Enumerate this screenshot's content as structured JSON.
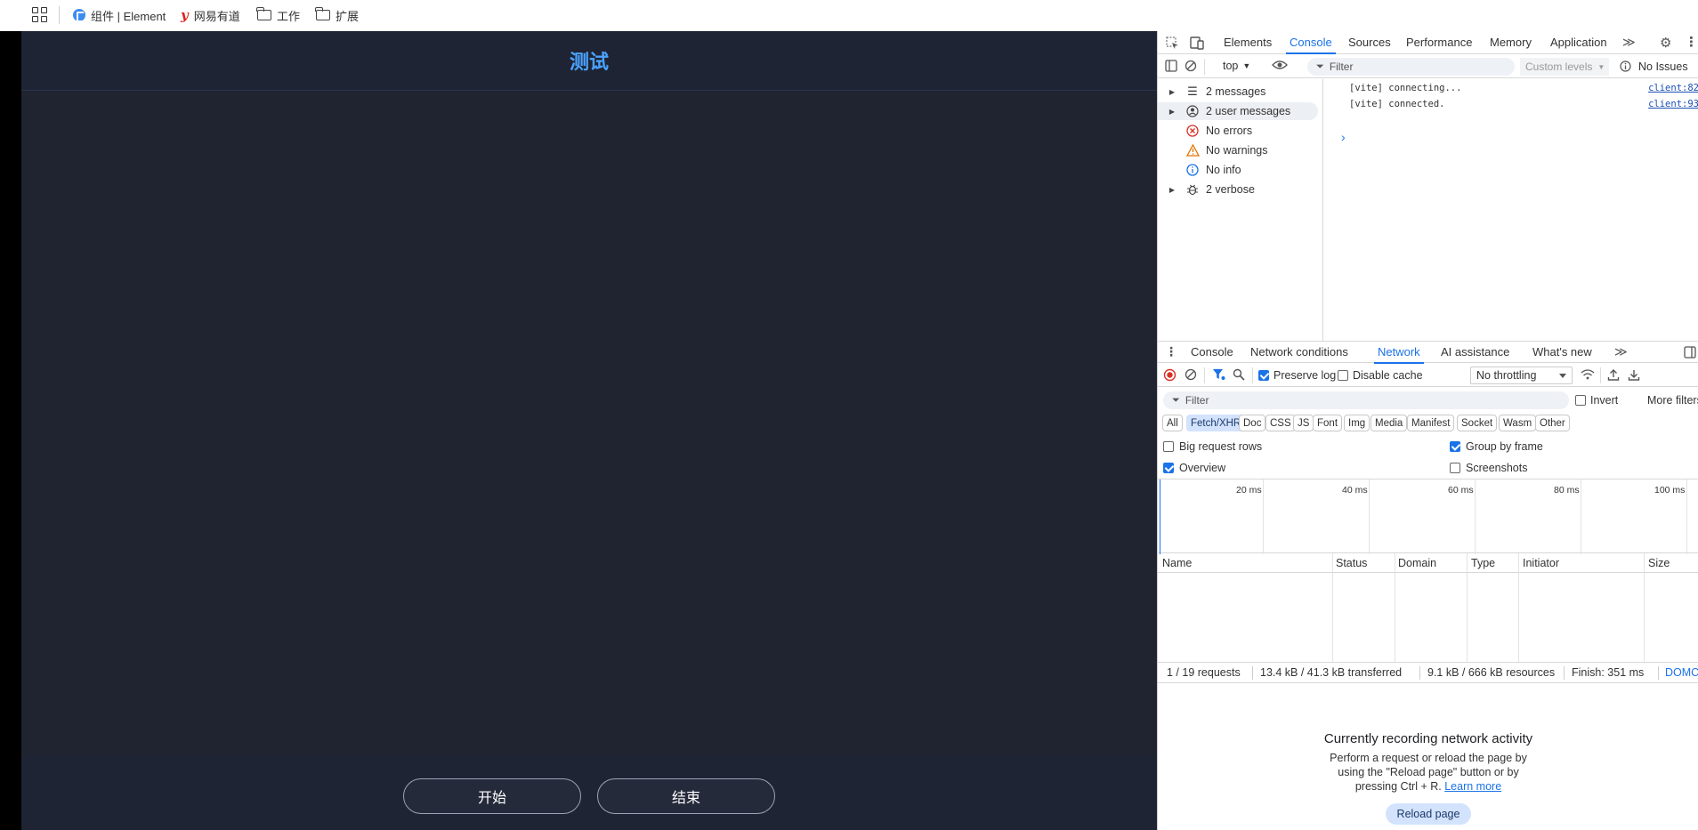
{
  "bookmarks": {
    "items": [
      "组件 | Element",
      "网易有道",
      "工作",
      "扩展"
    ]
  },
  "app": {
    "title": "测试",
    "buttons": {
      "start": "开始",
      "end": "结束"
    }
  },
  "devtools": {
    "tabs": [
      "Elements",
      "Console",
      "Sources",
      "Performance",
      "Memory",
      "Application"
    ],
    "active_tab": "Console",
    "console": {
      "context": "top",
      "filter_placeholder": "Filter",
      "levels": "Custom levels",
      "issues": "No Issues",
      "sidebar": [
        {
          "label": "2 messages",
          "icon": "list-icon",
          "expandable": true
        },
        {
          "label": "2 user messages",
          "icon": "user-icon",
          "expandable": true,
          "selected": true
        },
        {
          "label": "No errors",
          "icon": "error-icon",
          "expandable": false
        },
        {
          "label": "No warnings",
          "icon": "warning-icon",
          "expandable": false
        },
        {
          "label": "No info",
          "icon": "info-icon",
          "expandable": false
        },
        {
          "label": "2 verbose",
          "icon": "bug-icon",
          "expandable": true
        }
      ],
      "logs": [
        {
          "text": "[vite] connecting...",
          "source": "client:82"
        },
        {
          "text": "[vite] connected.",
          "source": "client:93"
        }
      ]
    },
    "drawer": {
      "tabs": [
        "Console",
        "Network conditions",
        "Network",
        "AI assistance",
        "What's new"
      ],
      "active_tab": "Network"
    },
    "network": {
      "preserve_log": "Preserve log",
      "disable_cache": "Disable cache",
      "throttling": "No throttling",
      "filter_placeholder": "Filter",
      "invert": "Invert",
      "more_filters": "More filters",
      "type_filters": [
        "All",
        "Fetch/XHR",
        "Doc",
        "CSS",
        "JS",
        "Font",
        "Img",
        "Media",
        "Manifest",
        "Socket",
        "Wasm",
        "Other"
      ],
      "active_filter": "Fetch/XHR",
      "options": {
        "big_request_rows": "Big request rows",
        "group_by_frame": "Group by frame",
        "overview": "Overview",
        "screenshots": "Screenshots"
      },
      "timeline_labels": [
        "20 ms",
        "40 ms",
        "60 ms",
        "80 ms",
        "100 ms"
      ],
      "columns": [
        "Name",
        "Status",
        "Domain",
        "Type",
        "Initiator",
        "Size"
      ],
      "summary": {
        "requests": "1 / 19 requests",
        "transferred": "13.4 kB / 41.3 kB transferred",
        "resources": "9.1 kB / 666 kB resources",
        "finish": "Finish: 351 ms",
        "dom": "DOMContentLoaded"
      },
      "empty": {
        "title": "Currently recording network activity",
        "desc_1": "Perform a request or reload the page by using the \"Reload page\" button or by pressing Ctrl + R.",
        "learn_more": "Learn more",
        "reload": "Reload page"
      }
    }
  }
}
